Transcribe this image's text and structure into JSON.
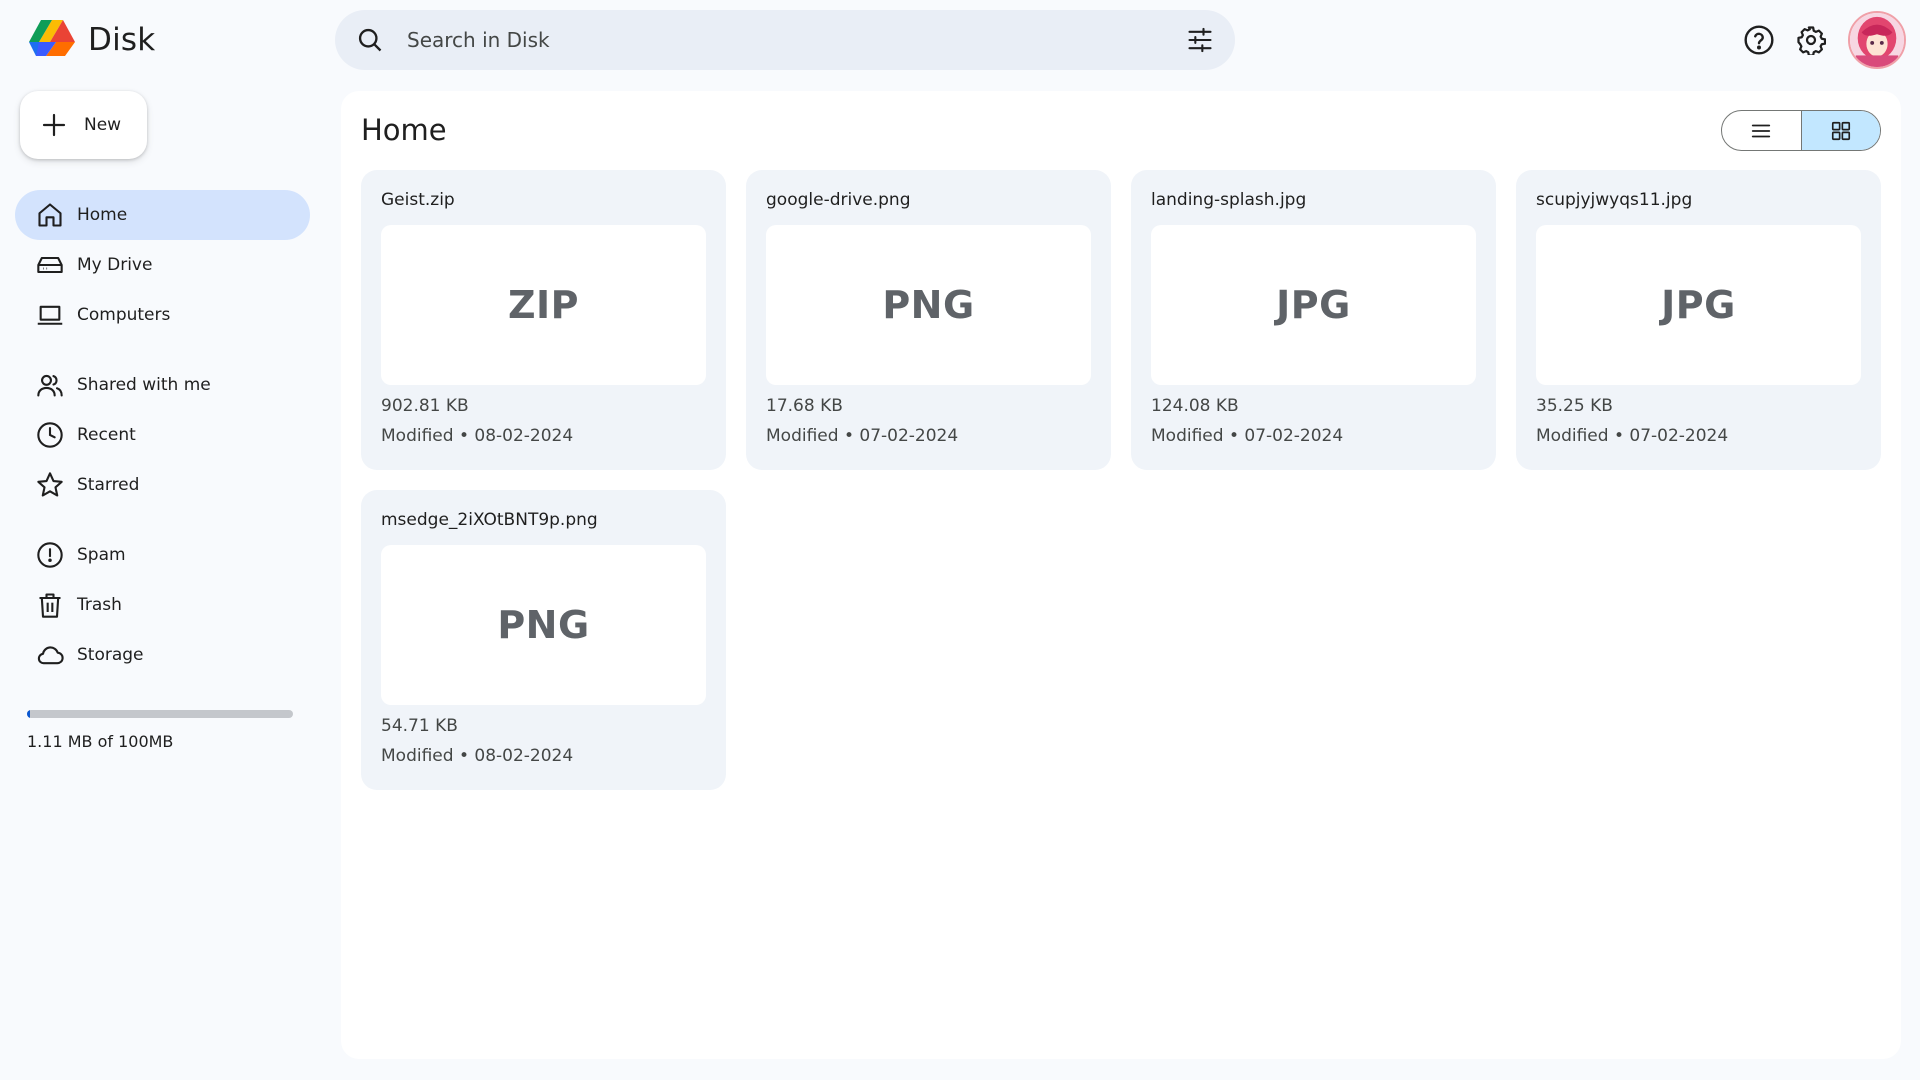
{
  "app": {
    "name": "Disk",
    "logo_icon": "disk-logo-icon"
  },
  "search": {
    "placeholder": "Search in Disk",
    "icon": "search-icon",
    "filter_icon": "tune-icon"
  },
  "header_actions": {
    "help_icon": "help-icon",
    "settings_icon": "gear-icon",
    "avatar": "user-avatar"
  },
  "new_button": {
    "label": "New",
    "icon": "plus-icon"
  },
  "sidebar": {
    "items": [
      {
        "label": "Home",
        "icon": "home-icon",
        "active": true
      },
      {
        "label": "My Drive",
        "icon": "drive-icon",
        "active": false
      },
      {
        "label": "Computers",
        "icon": "laptop-icon",
        "active": false
      },
      {
        "label": "Shared with me",
        "icon": "people-icon",
        "active": false
      },
      {
        "label": "Recent",
        "icon": "clock-icon",
        "active": false
      },
      {
        "label": "Starred",
        "icon": "star-icon",
        "active": false
      },
      {
        "label": "Spam",
        "icon": "spam-icon",
        "active": false
      },
      {
        "label": "Trash",
        "icon": "trash-icon",
        "active": false
      },
      {
        "label": "Storage",
        "icon": "cloud-icon",
        "active": false
      }
    ]
  },
  "storage": {
    "text": "1.11 MB of 100MB",
    "used_fraction": 0.0111
  },
  "main": {
    "title": "Home",
    "view_modes": [
      {
        "name": "list",
        "icon": "list-view-icon",
        "active": false
      },
      {
        "name": "grid",
        "icon": "grid-view-icon",
        "active": true
      }
    ],
    "files": [
      {
        "name": "Geist.zip",
        "type_label": "ZIP",
        "size": "902.81 KB",
        "modified": "Modified • 08-02-2024"
      },
      {
        "name": "google-drive.png",
        "type_label": "PNG",
        "size": "17.68 KB",
        "modified": "Modified • 07-02-2024"
      },
      {
        "name": "landing-splash.jpg",
        "type_label": "JPG",
        "size": "124.08 KB",
        "modified": "Modified • 07-02-2024"
      },
      {
        "name": "scupjyjwyqs11.jpg",
        "type_label": "JPG",
        "size": "35.25 KB",
        "modified": "Modified • 07-02-2024"
      },
      {
        "name": "msedge_2iXOtBNT9p.png",
        "type_label": "PNG",
        "size": "54.71 KB",
        "modified": "Modified • 08-02-2024"
      }
    ]
  },
  "colors": {
    "page_bg": "#f8fafd",
    "active_nav": "#d3e3fd",
    "card_bg": "#f0f4f9",
    "search_bg": "#e9eef6",
    "accent": "#0b57d0"
  }
}
